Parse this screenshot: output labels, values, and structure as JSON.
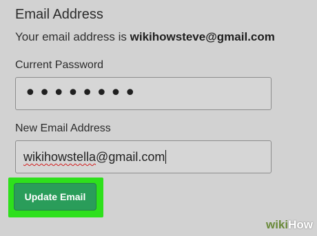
{
  "section": {
    "title": "Email Address"
  },
  "current_email": {
    "prefix": "Your email address is ",
    "value": "wikihowsteve@gmail.com"
  },
  "current_password": {
    "label": "Current Password",
    "masked_value": "••••••••"
  },
  "new_email": {
    "label": "New Email Address",
    "value_misspelled_part": "wikihowstella",
    "value_rest": "@gmail.com"
  },
  "update_button": {
    "label": "Update Email"
  },
  "watermark": {
    "part1": "wiki",
    "part2": "How"
  },
  "colors": {
    "background": "#d2d2d2",
    "button": "#2a9d5a",
    "highlight": "#2ee01c",
    "spellcheck": "#d21c1c"
  }
}
